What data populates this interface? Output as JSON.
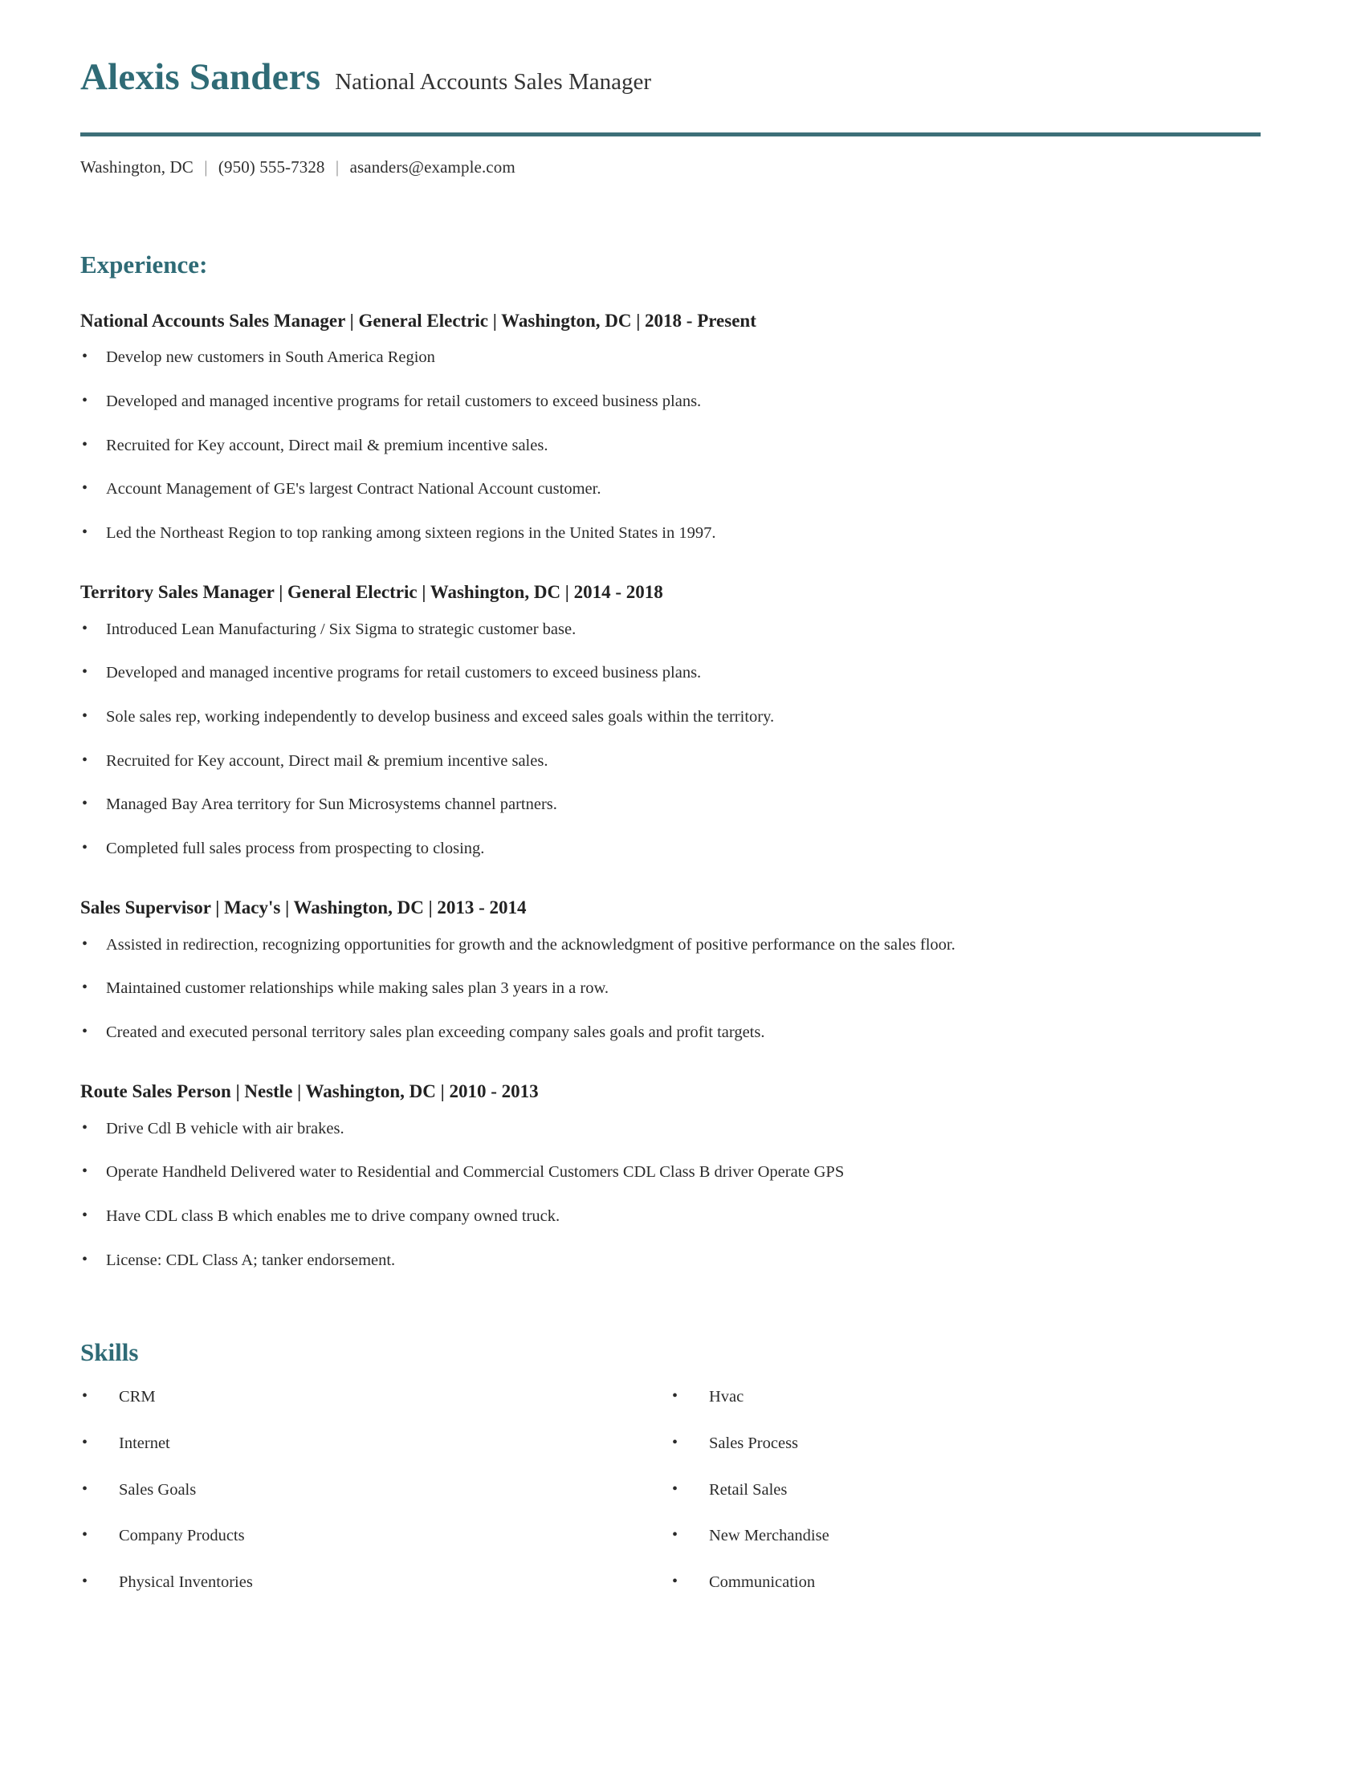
{
  "theme": {
    "accent": "#2f6b76",
    "rule": "#3d6f78",
    "text": "#2b2b2b",
    "heading_text": "#222222"
  },
  "header": {
    "full_name": "Alexis Sanders",
    "job_title": "National Accounts Sales Manager",
    "contact": {
      "location": "Washington, DC",
      "separator": "|",
      "phone": "(950) 555-7328",
      "email": "asanders@example.com"
    }
  },
  "experience": {
    "section_title": "Experience:",
    "jobs": [
      {
        "heading": "National Accounts Sales Manager | General Electric | Washington, DC | 2018 - Present",
        "bullets": [
          "Develop new customers in South America Region",
          "Developed and managed incentive programs for retail customers to exceed business plans.",
          "Recruited for Key account, Direct mail & premium incentive sales.",
          "Account Management of GE's largest Contract National Account customer.",
          "Led the Northeast Region to top ranking among sixteen regions in the United States in 1997."
        ]
      },
      {
        "heading": "Territory Sales Manager | General Electric | Washington, DC | 2014 - 2018",
        "bullets": [
          "Introduced Lean Manufacturing / Six Sigma to strategic customer base.",
          "Developed and managed incentive programs for retail customers to exceed business plans.",
          "Sole sales rep, working independently to develop business and exceed sales goals within the territory.",
          "Recruited for Key account, Direct mail & premium incentive sales.",
          "Managed Bay Area territory for Sun Microsystems channel partners.",
          "Completed full sales process from prospecting to closing."
        ]
      },
      {
        "heading": "Sales Supervisor | Macy's | Washington, DC | 2013 - 2014",
        "bullets": [
          "Assisted in redirection, recognizing opportunities for growth and the acknowledgment of positive performance on the sales floor.",
          "Maintained customer relationships while making sales plan 3 years in a row.",
          "Created and executed personal territory sales plan exceeding company sales goals and profit targets."
        ]
      },
      {
        "heading": "Route Sales Person | Nestle | Washington, DC | 2010 - 2013",
        "bullets": [
          "Drive Cdl B vehicle with air brakes.",
          "Operate Handheld Delivered water to Residential and Commercial Customers CDL Class B driver Operate GPS",
          "Have CDL class B which enables me to drive company owned truck.",
          "License: CDL Class A; tanker endorsement."
        ]
      }
    ]
  },
  "skills": {
    "section_title": "Skills",
    "column_left": [
      "CRM",
      "Internet",
      "Sales Goals",
      "Company Products",
      "Physical Inventories"
    ],
    "column_right": [
      "Hvac",
      "Sales Process",
      "Retail Sales",
      "New Merchandise",
      "Communication"
    ]
  }
}
